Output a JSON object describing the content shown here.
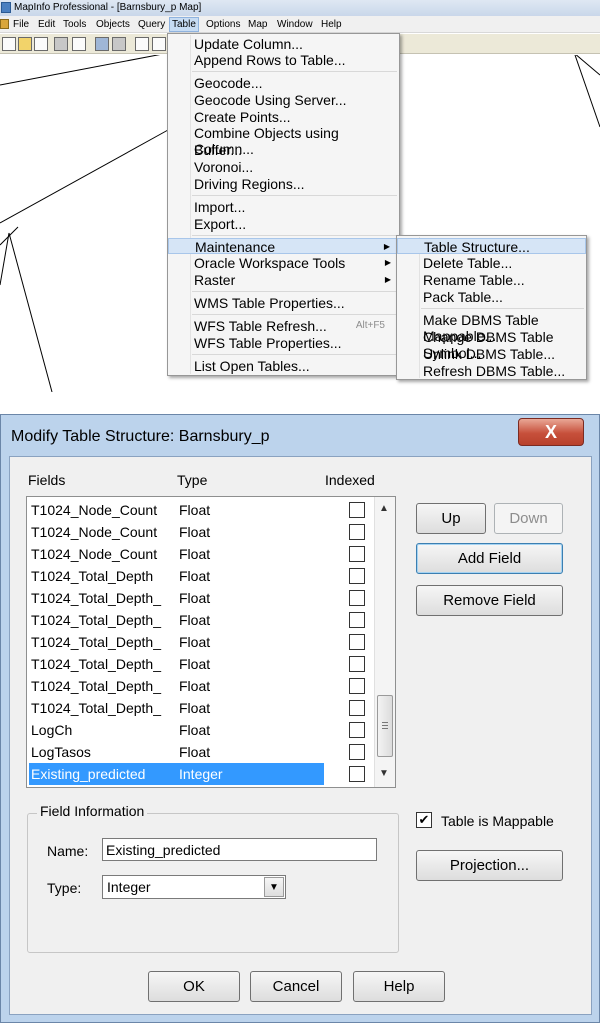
{
  "window": {
    "title": "MapInfo Professional - [Barnsbury_p Map]"
  },
  "menubar": {
    "items": [
      "File",
      "Edit",
      "Tools",
      "Objects",
      "Query",
      "Table",
      "Options",
      "Map",
      "Window",
      "Help"
    ],
    "active": "Table"
  },
  "table_menu": {
    "items": [
      {
        "label": "Update Column...",
        "enabled": true
      },
      {
        "label": "Append Rows to Table...",
        "enabled": false
      },
      {
        "label": "Geocode...",
        "enabled": true
      },
      {
        "label": "Geocode Using Server...",
        "enabled": true
      },
      {
        "label": "Create Points...",
        "enabled": true
      },
      {
        "label": "Combine Objects using Column...",
        "enabled": true
      },
      {
        "label": "Buffer...",
        "enabled": true
      },
      {
        "label": "Voronoi...",
        "enabled": false
      },
      {
        "label": "Driving Regions...",
        "enabled": true
      },
      {
        "label": "Import...",
        "enabled": true
      },
      {
        "label": "Export...",
        "enabled": true
      },
      {
        "label": "Maintenance",
        "enabled": true,
        "submenu": true
      },
      {
        "label": "Oracle Workspace Tools",
        "enabled": true,
        "submenu": true
      },
      {
        "label": "Raster",
        "enabled": true,
        "submenu": true
      },
      {
        "label": "WMS Table Properties...",
        "enabled": false
      },
      {
        "label": "WFS Table Refresh...",
        "enabled": false,
        "shortcut": "Alt+F5"
      },
      {
        "label": "WFS Table Properties...",
        "enabled": false
      },
      {
        "label": "List Open Tables...",
        "enabled": true
      }
    ]
  },
  "maintenance_submenu": {
    "items": [
      {
        "label": "Table Structure...",
        "enabled": true
      },
      {
        "label": "Delete Table...",
        "enabled": true
      },
      {
        "label": "Rename Table...",
        "enabled": true
      },
      {
        "label": "Pack Table...",
        "enabled": true
      },
      {
        "label": "Make DBMS Table Mappable...",
        "enabled": false
      },
      {
        "label": "Change DBMS Table Symbol...",
        "enabled": false
      },
      {
        "label": "Unlink DBMS Table...",
        "enabled": false
      },
      {
        "label": "Refresh DBMS Table...",
        "enabled": false
      }
    ]
  },
  "dialog": {
    "title": "Modify Table Structure: Barnsbury_p",
    "close_glyph": "X",
    "headers": {
      "fields": "Fields",
      "type": "Type",
      "indexed": "Indexed"
    },
    "fields": [
      {
        "name": "T1024_Node_Count",
        "type": "Float",
        "indexed": false
      },
      {
        "name": "T1024_Node_Count",
        "type": "Float",
        "indexed": false
      },
      {
        "name": "T1024_Node_Count",
        "type": "Float",
        "indexed": false
      },
      {
        "name": "T1024_Total_Depth",
        "type": "Float",
        "indexed": false
      },
      {
        "name": "T1024_Total_Depth_",
        "type": "Float",
        "indexed": false
      },
      {
        "name": "T1024_Total_Depth_",
        "type": "Float",
        "indexed": false
      },
      {
        "name": "T1024_Total_Depth_",
        "type": "Float",
        "indexed": false
      },
      {
        "name": "T1024_Total_Depth_",
        "type": "Float",
        "indexed": false
      },
      {
        "name": "T1024_Total_Depth_",
        "type": "Float",
        "indexed": false
      },
      {
        "name": "T1024_Total_Depth_",
        "type": "Float",
        "indexed": false
      },
      {
        "name": "LogCh",
        "type": "Float",
        "indexed": false
      },
      {
        "name": "LogTasos",
        "type": "Float",
        "indexed": false
      },
      {
        "name": "Existing_predicted",
        "type": "Integer",
        "indexed": false,
        "selected": true
      }
    ],
    "buttons": {
      "up": "Up",
      "down": "Down",
      "add_field": "Add Field",
      "remove_field": "Remove Field",
      "projection": "Projection...",
      "ok": "OK",
      "cancel": "Cancel",
      "help": "Help"
    },
    "field_info": {
      "group_label": "Field Information",
      "name_label": "Name:",
      "name_value": "Existing_predicted",
      "type_label": "Type:",
      "type_value": "Integer"
    },
    "table_is_mappable": {
      "label": "Table is Mappable",
      "checked": true
    }
  }
}
